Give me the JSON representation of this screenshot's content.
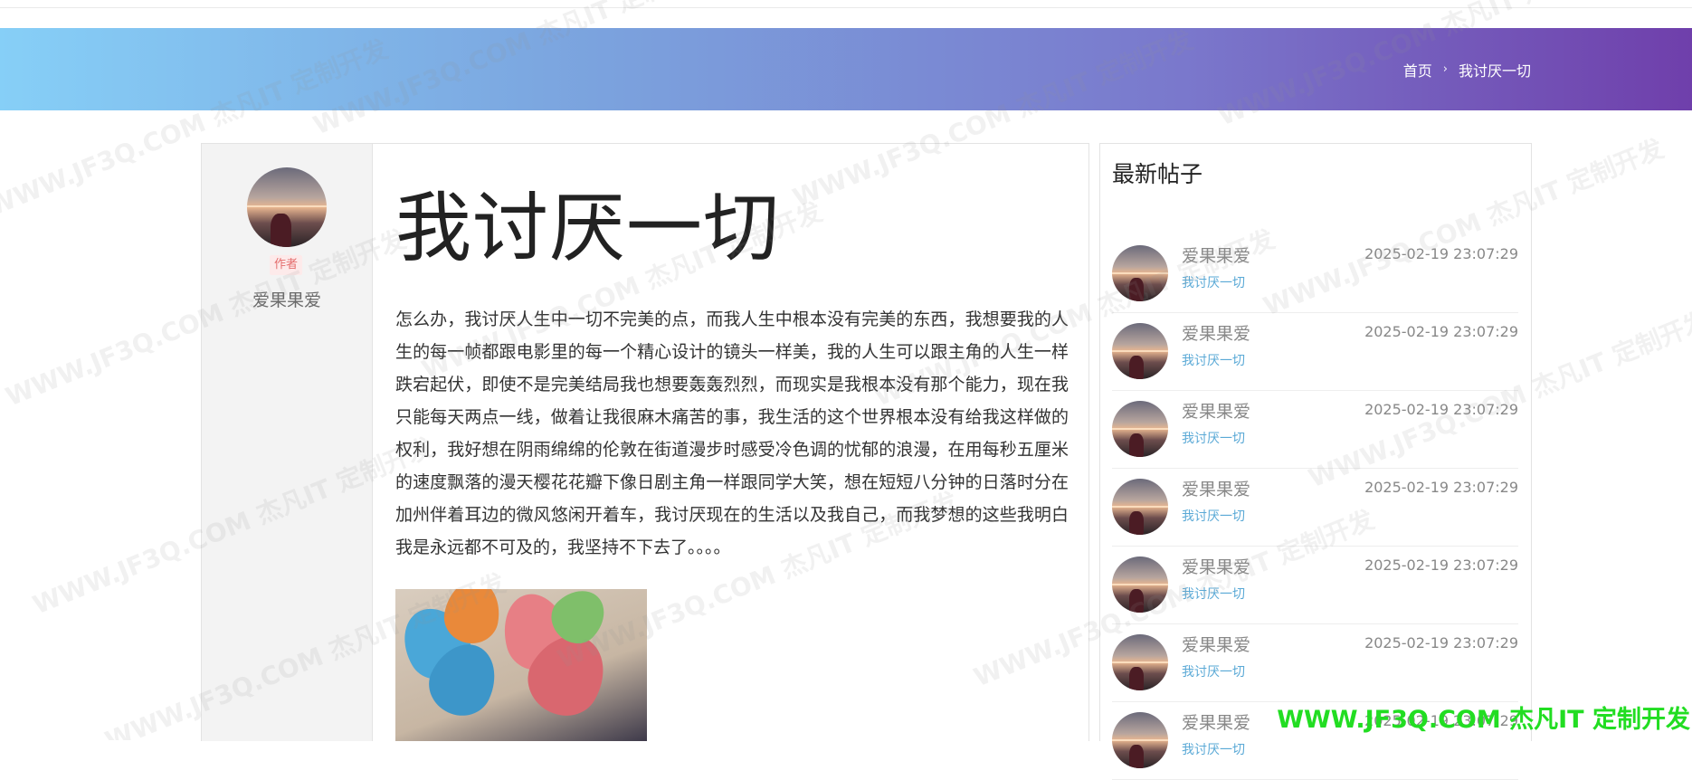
{
  "breadcrumb": {
    "home": "首页",
    "separator": "›",
    "current": "我讨厌一切"
  },
  "article": {
    "author_tag": "作者",
    "author_name": "爱果果爱",
    "title": "我讨厌一切",
    "body": "怎么办，我讨厌人生中一切不完美的点，而我人生中根本没有完美的东西，我想要我的人生的每一帧都跟电影里的每一个精心设计的镜头一样美，我的人生可以跟主角的人生一样跌宕起伏，即使不是完美结局我也想要轰轰烈烈，而现实是我根本没有那个能力，现在我只能每天两点一线，做着让我很麻木痛苦的事，我生活的这个世界根本没有给我这样做的权利，我好想在阴雨绵绵的伦敦在街道漫步时感受冷色调的忧郁的浪漫，在用每秒五厘米的速度飘落的漫天樱花花瓣下像日剧主角一样跟同学大笑，想在短短八分钟的日落时分在加州伴着耳边的微风悠闲开着车，我讨厌现在的生活以及我自己，而我梦想的这些我明白我是永远都不可及的，我坚持不下去了。。。。"
  },
  "sidebar": {
    "title": "最新帖子",
    "items": [
      {
        "author": "爱果果爱",
        "date": "2025-02-19 23:07:29",
        "title": "我讨厌一切"
      },
      {
        "author": "爱果果爱",
        "date": "2025-02-19 23:07:29",
        "title": "我讨厌一切"
      },
      {
        "author": "爱果果爱",
        "date": "2025-02-19 23:07:29",
        "title": "我讨厌一切"
      },
      {
        "author": "爱果果爱",
        "date": "2025-02-19 23:07:29",
        "title": "我讨厌一切"
      },
      {
        "author": "爱果果爱",
        "date": "2025-02-19 23:07:29",
        "title": "我讨厌一切"
      },
      {
        "author": "爱果果爱",
        "date": "2025-02-19 23:07:29",
        "title": "我讨厌一切"
      },
      {
        "author": "爱果果爱",
        "date": "2025-02-19 23:07:29",
        "title": "我讨厌一切"
      }
    ]
  },
  "watermark": {
    "text": "WWW.JF3Q.COM 杰凡IT 定制开发",
    "bottom_text": "WWW.JF3Q.COM 杰凡IT 定制开发"
  },
  "colors": {
    "banner_start": "#86cff7",
    "banner_end": "#6f3fab",
    "link": "#5aa9d6",
    "tag": "#e46d6d",
    "watermark_bottom": "#22dd22"
  }
}
